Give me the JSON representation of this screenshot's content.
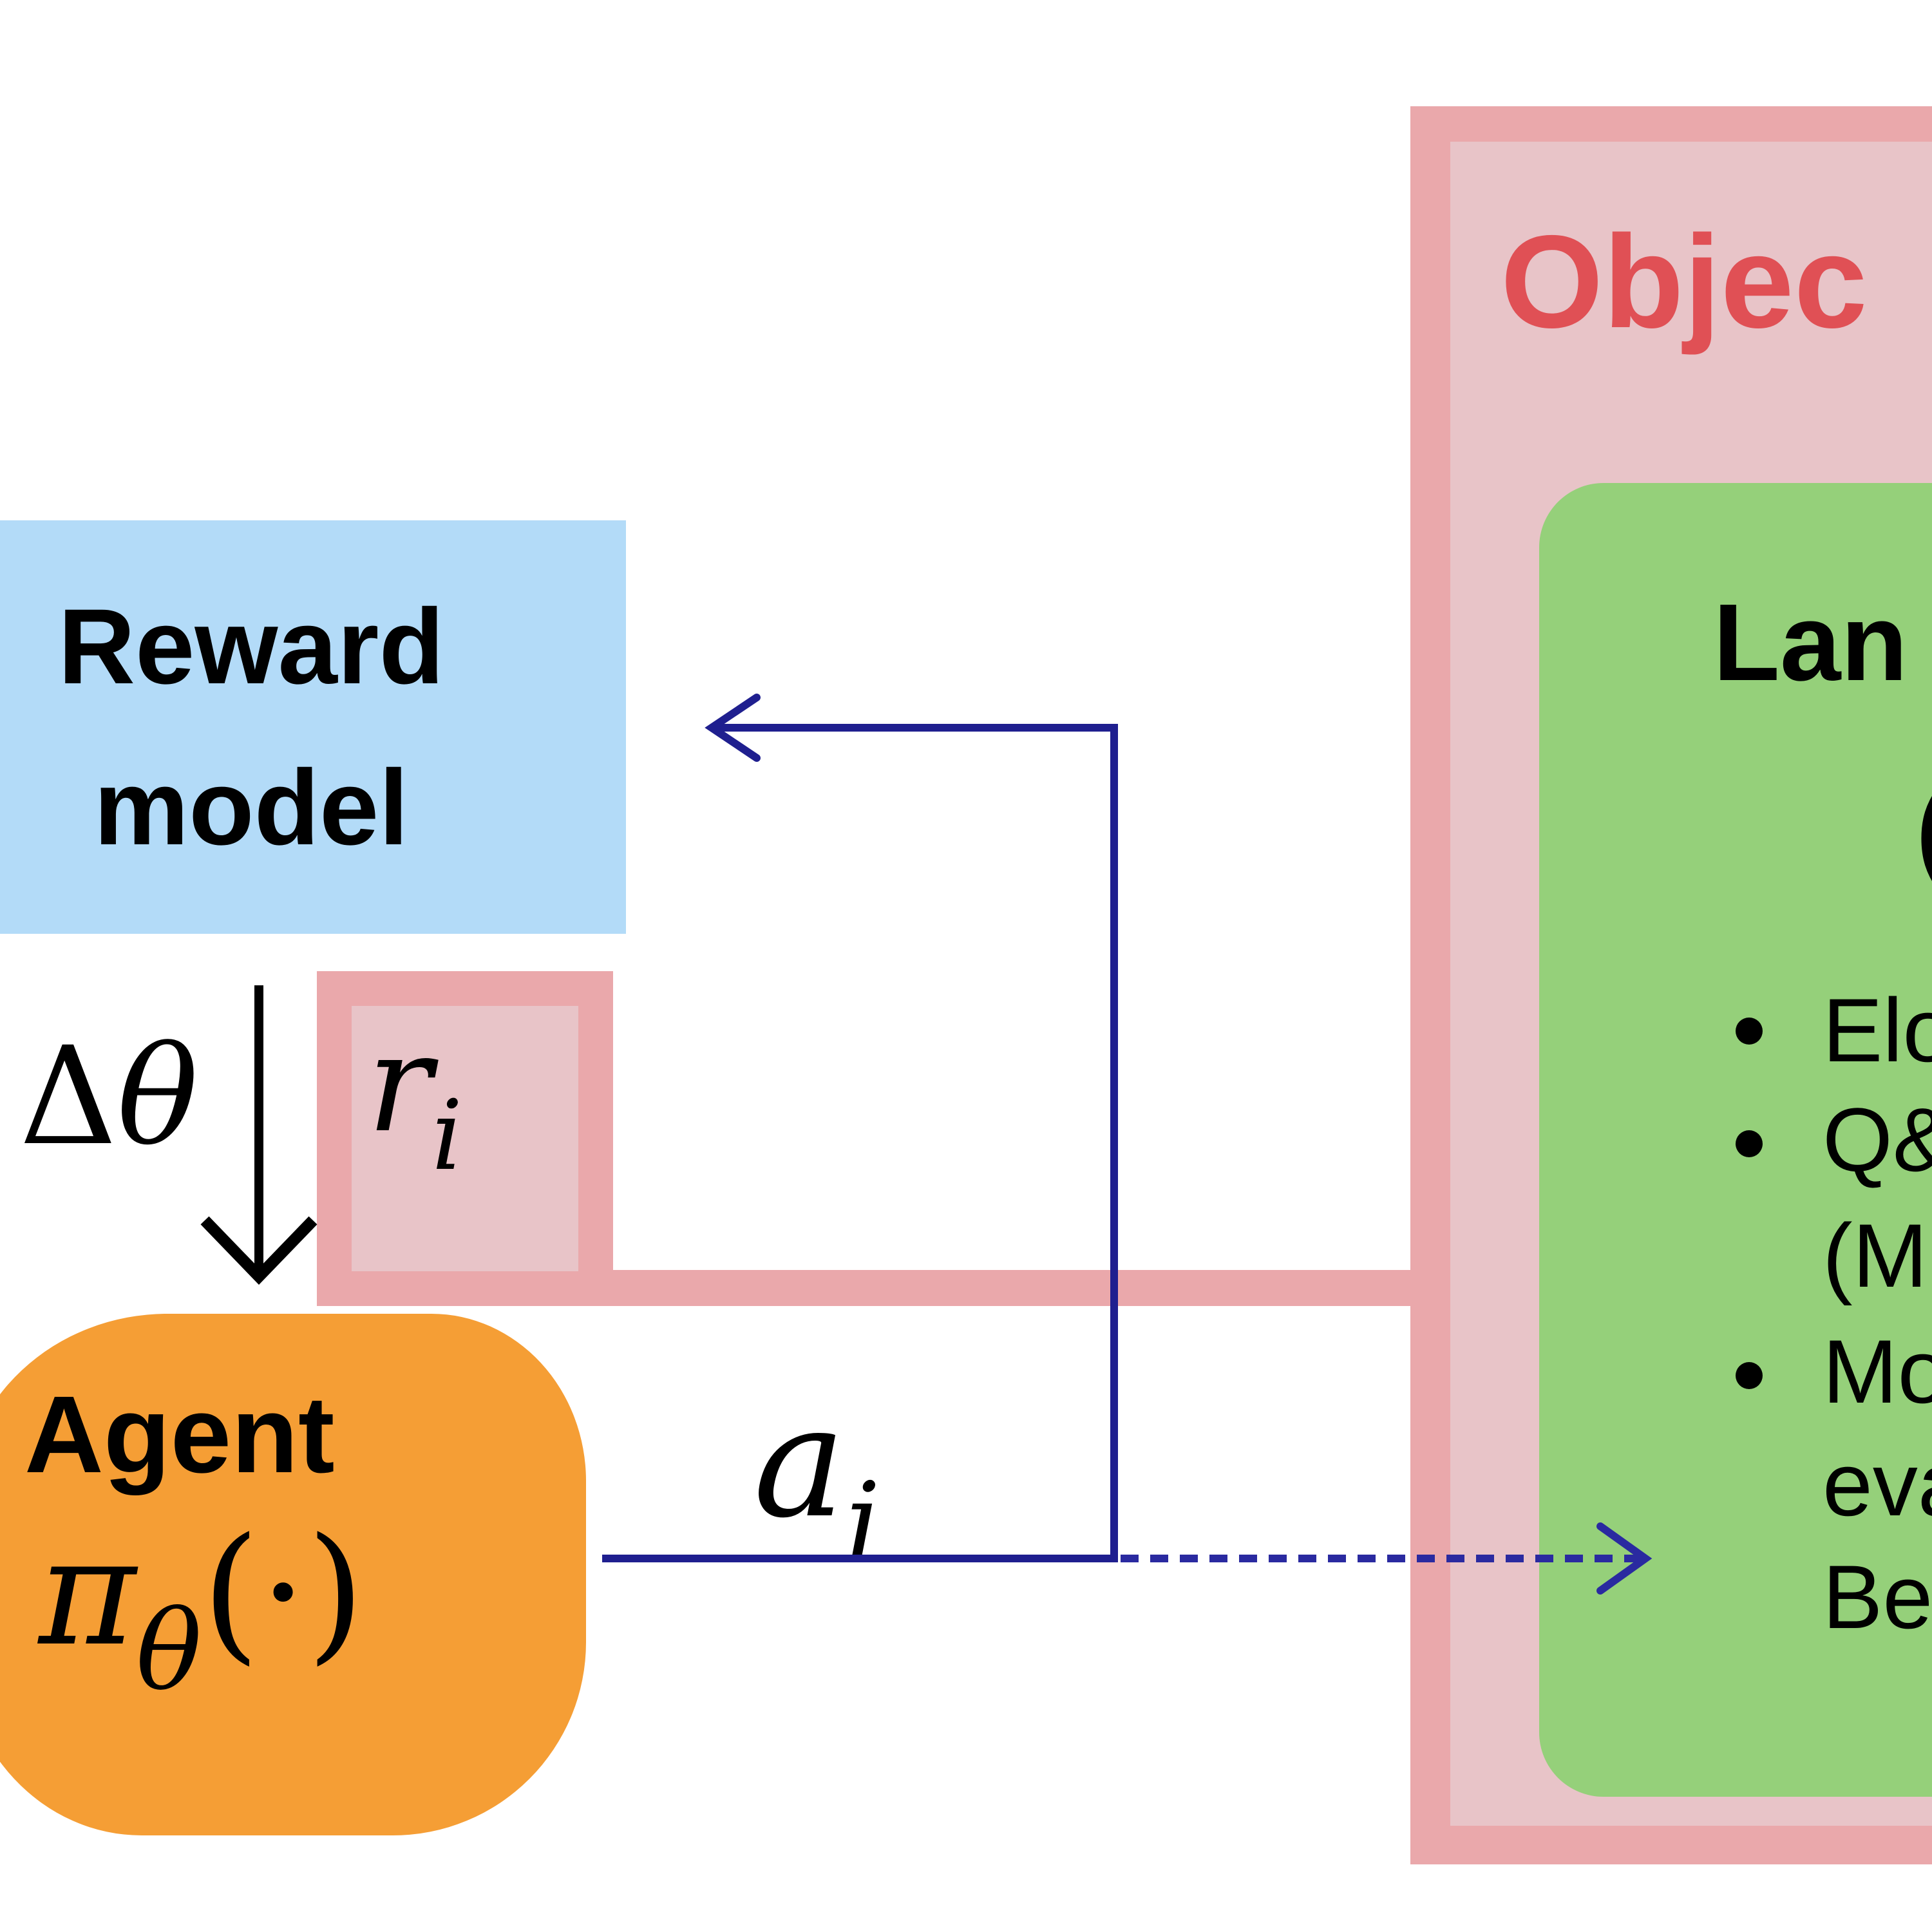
{
  "diagram": {
    "reward_model": {
      "label_line1": "Reward",
      "label_line2": "model"
    },
    "reward_signal": {
      "symbol": "r",
      "subscript": "i"
    },
    "update": {
      "delta": "Δ",
      "theta": "θ"
    },
    "agent": {
      "label": "Agent",
      "policy_symbol": "π",
      "policy_subscript": "θ",
      "policy_args": "(·)"
    },
    "action": {
      "symbol": "a",
      "subscript": "i"
    },
    "objective": {
      "title": "Objec",
      "card": {
        "title_line1": "Lan",
        "title_line2": "(",
        "bullets": [
          {
            "lines": [
              "Elo"
            ]
          },
          {
            "lines": [
              "Q&",
              "(M"
            ]
          },
          {
            "lines": [
              "Mo",
              "eva",
              "Be"
            ]
          }
        ]
      }
    },
    "colors": {
      "reward_box": "#b3dbf8",
      "objective_border": "#eaa8ab",
      "objective_fill": "#e8c4c8",
      "objective_title": "#e05055",
      "card_green": "#95d07a",
      "agent_orange": "#f59e35",
      "arrow_blue": "#1f1f8f"
    }
  }
}
